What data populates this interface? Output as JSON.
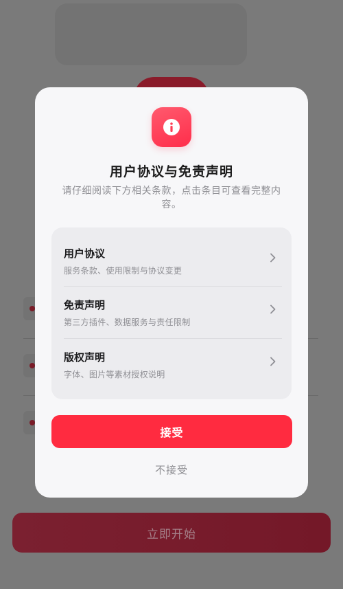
{
  "background": {
    "start_button_label": "立即开始"
  },
  "dialog": {
    "icon": "info-icon",
    "title": "用户协议与免责声明",
    "subtitle": "请仔细阅读下方相关条款，点击条目可查看完整内容。",
    "items": [
      {
        "title": "用户协议",
        "description": "服务条款、使用限制与协议变更",
        "icon": "chevron-right-icon"
      },
      {
        "title": "免责声明",
        "description": "第三方插件、数据服务与责任限制",
        "icon": "chevron-right-icon"
      },
      {
        "title": "版权声明",
        "description": "字体、图片等素材授权说明",
        "icon": "chevron-right-icon"
      }
    ],
    "accept_label": "接受",
    "decline_label": "不接受"
  },
  "colors": {
    "accent": "#ff2b40",
    "overlay": "#6b6b6b",
    "dialog_bg": "#f7f7f9"
  }
}
